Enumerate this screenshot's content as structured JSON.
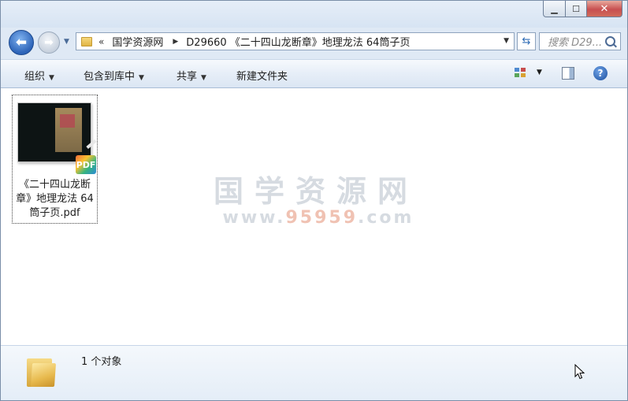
{
  "titlebar": {
    "minimize": "▁",
    "maximize": "☐",
    "close": "✕"
  },
  "address": {
    "chevron": "«",
    "breadcrumbs": [
      "国学资源网",
      "D29660 《二十四山龙断章》地理龙法 64筒子页"
    ],
    "search_placeholder": "搜索 D29..."
  },
  "toolbar": {
    "organize": "组织",
    "include_library": "包含到库中",
    "share": "共享",
    "new_folder": "新建文件夹",
    "help": "?"
  },
  "files": [
    {
      "name": "《二十四山龙断章》地理龙法 64筒子页.pdf",
      "badge": "PDF",
      "selected": true
    }
  ],
  "watermark": {
    "title": "国学资源网",
    "url_pre": "www.",
    "url_hl": "95959",
    "url_post": ".com"
  },
  "status": {
    "count_text": "1 个对象"
  },
  "colors": {
    "accent": "#2c63b8",
    "close": "#c75050",
    "watermark": "#d6dbe1"
  }
}
